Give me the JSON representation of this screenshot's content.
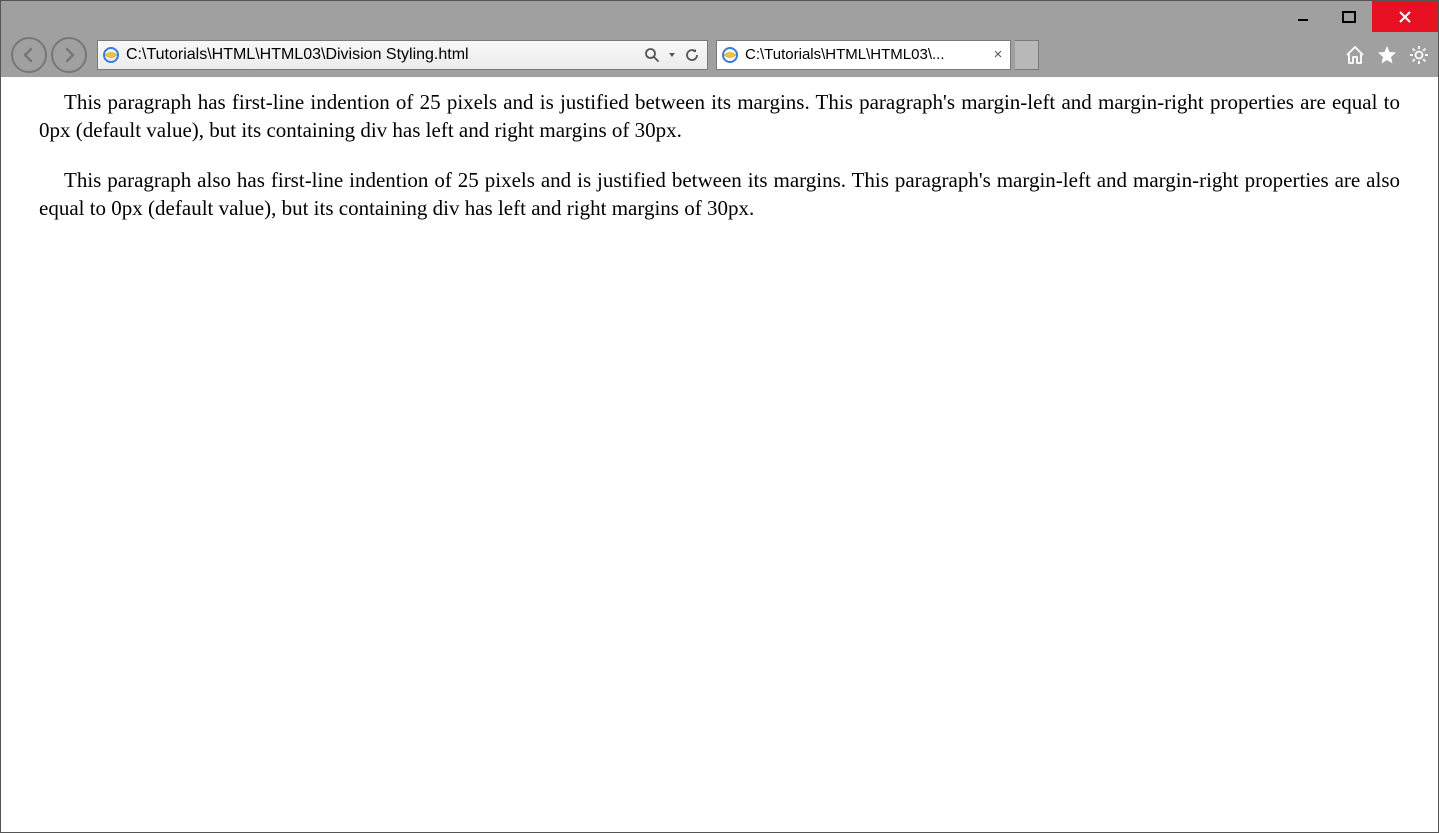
{
  "window": {
    "min_icon": "minimize-icon",
    "max_icon": "maximize-icon",
    "close_icon": "close-icon"
  },
  "nav": {
    "back_icon": "back-icon",
    "forward_icon": "forward-icon"
  },
  "addressbar": {
    "favicon": "ie-favicon",
    "url": "C:\\Tutorials\\HTML\\HTML03\\Division Styling.html",
    "search_icon": "search-icon",
    "dropdown_icon": "dropdown-icon",
    "refresh_icon": "refresh-icon"
  },
  "tab": {
    "favicon": "ie-favicon",
    "title": "C:\\Tutorials\\HTML\\HTML03\\...",
    "close_icon": "tab-close-icon"
  },
  "toolbar": {
    "home_icon": "home-icon",
    "favorites_icon": "star-icon",
    "tools_icon": "gear-icon"
  },
  "content": {
    "paragraph1": "This paragraph has first-line indention of 25 pixels and is justified between its margins. This paragraph's margin-left and margin-right properties are equal to 0px (default value), but its containing div has left and right margins of 30px.",
    "paragraph2": "This paragraph also has first-line indention of 25 pixels and is justified between its margins. This paragraph's margin-left and margin-right properties are also equal to 0px (default value), but its containing div has left and right margins of 30px."
  }
}
